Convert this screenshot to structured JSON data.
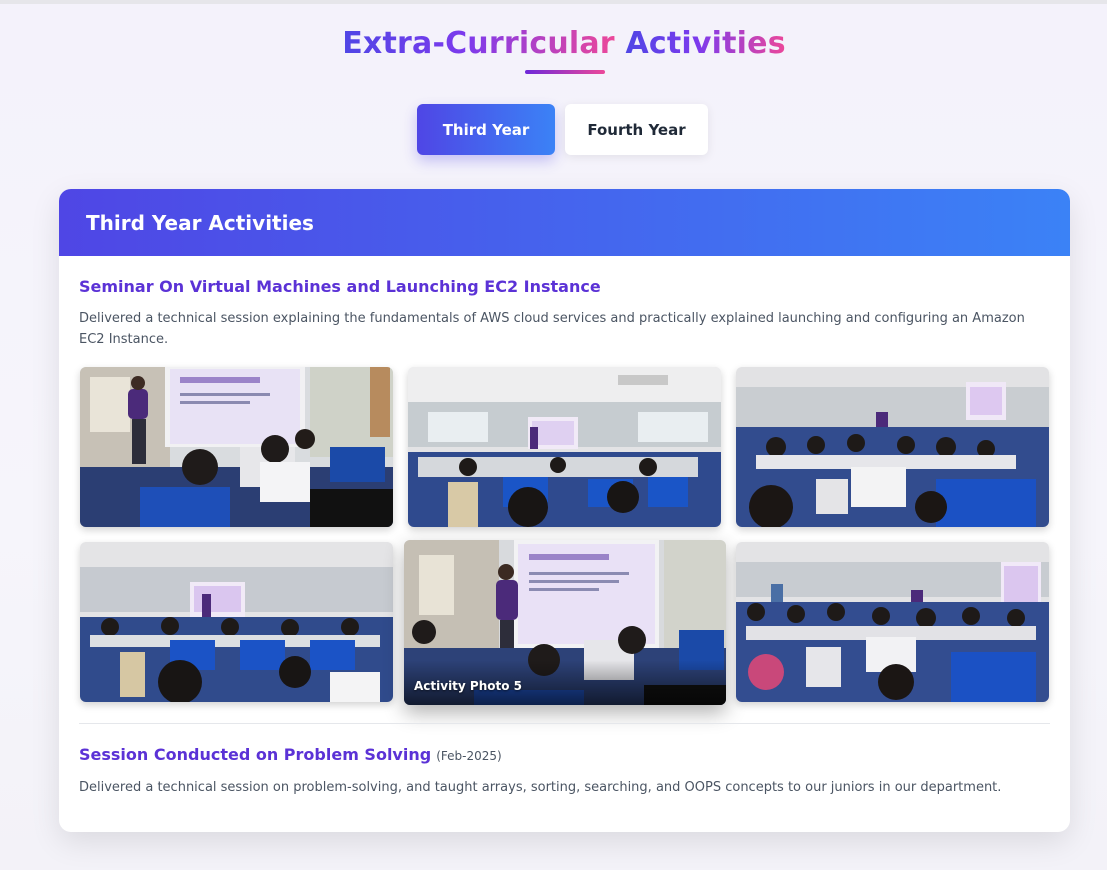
{
  "page": {
    "title_part1": "Extra-Curricular",
    "title_part2": "Activities"
  },
  "tabs": [
    {
      "label": "Third Year",
      "active": true
    },
    {
      "label": "Fourth Year",
      "active": false
    }
  ],
  "panel": {
    "header": "Third Year Activities",
    "activities": [
      {
        "title": "Seminar On Virtual Machines and Launching EC2 Instance",
        "description": "Delivered a technical session explaining the fundamentals of AWS cloud services and practically explained launching and configuring an Amazon EC2 Instance.",
        "photos": [
          {
            "icon": "classroom-photo-1"
          },
          {
            "icon": "classroom-photo-2"
          },
          {
            "icon": "classroom-photo-3"
          },
          {
            "icon": "classroom-photo-4"
          },
          {
            "icon": "classroom-photo-5",
            "caption": "Activity Photo 5"
          },
          {
            "icon": "classroom-photo-6"
          }
        ]
      },
      {
        "title": "Session Conducted on Problem Solving",
        "date": "(Feb-2025)",
        "description": "Delivered a technical session on problem-solving, and taught arrays, sorting, searching, and OOPS concepts to our juniors in our department."
      }
    ]
  },
  "colors": {
    "primary": "#4f46e5",
    "secondary": "#3b82f6",
    "accent_pink": "#ec4899",
    "title_purple": "#5b32d6"
  }
}
